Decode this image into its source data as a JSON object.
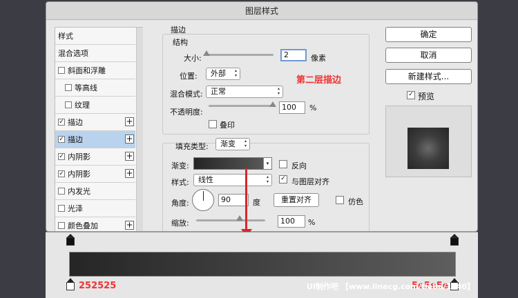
{
  "dialog": {
    "title": "图层样式"
  },
  "list": {
    "items": [
      {
        "label": "样式",
        "checkbox": false,
        "checked": false,
        "plus": false,
        "selected": false
      },
      {
        "label": "混合选项",
        "checkbox": false,
        "checked": false,
        "plus": false,
        "selected": false
      },
      {
        "label": "斜面和浮雕",
        "checkbox": true,
        "checked": false,
        "plus": false,
        "selected": false
      },
      {
        "label": "等高线",
        "checkbox": true,
        "checked": false,
        "plus": false,
        "selected": false,
        "indent": true
      },
      {
        "label": "纹理",
        "checkbox": true,
        "checked": false,
        "plus": false,
        "selected": false,
        "indent": true
      },
      {
        "label": "描边",
        "checkbox": true,
        "checked": true,
        "plus": true,
        "selected": false
      },
      {
        "label": "描边",
        "checkbox": true,
        "checked": true,
        "plus": true,
        "selected": true
      },
      {
        "label": "内阴影",
        "checkbox": true,
        "checked": true,
        "plus": true,
        "selected": false
      },
      {
        "label": "内阴影",
        "checkbox": true,
        "checked": true,
        "plus": true,
        "selected": false
      },
      {
        "label": "内发光",
        "checkbox": true,
        "checked": false,
        "plus": false,
        "selected": false
      },
      {
        "label": "光泽",
        "checkbox": true,
        "checked": false,
        "plus": false,
        "selected": false
      },
      {
        "label": "颜色叠加",
        "checkbox": true,
        "checked": false,
        "plus": true,
        "selected": false
      }
    ]
  },
  "stroke": {
    "section_title": "描边",
    "structure_title": "结构",
    "size_label": "大小:",
    "size_value": "2",
    "size_unit": "像素",
    "position_label": "位置:",
    "position_value": "外部",
    "blend_label": "混合模式:",
    "blend_value": "正常",
    "opacity_label": "不透明度:",
    "opacity_value": "100",
    "opacity_unit": "%",
    "overprint_label": "叠印"
  },
  "fill": {
    "fill_type_label": "填充类型:",
    "fill_type_value": "渐变",
    "gradient_label": "渐变:",
    "reverse_label": "反向",
    "style_label": "样式:",
    "style_value": "线性",
    "align_label": "与图层对齐",
    "angle_label": "角度:",
    "angle_value": "90",
    "angle_unit": "度",
    "reset_align_label": "重置对齐",
    "dither_label": "仿色",
    "scale_label": "缩放:",
    "scale_value": "100",
    "scale_unit": "%"
  },
  "buttons": {
    "ok": "确定",
    "cancel": "取消",
    "new_style": "新建样式...",
    "preview": "预览"
  },
  "annotations": {
    "second_stroke": "第二层描边",
    "left_color": "252525",
    "right_color": "5e5e5e"
  },
  "watermark": "UI制作吧 【www.linecg.com/tieba/1840】",
  "colors": {
    "gradient_start": "#252525",
    "gradient_end": "#5e5e5e",
    "accent_red": "#e33333"
  }
}
